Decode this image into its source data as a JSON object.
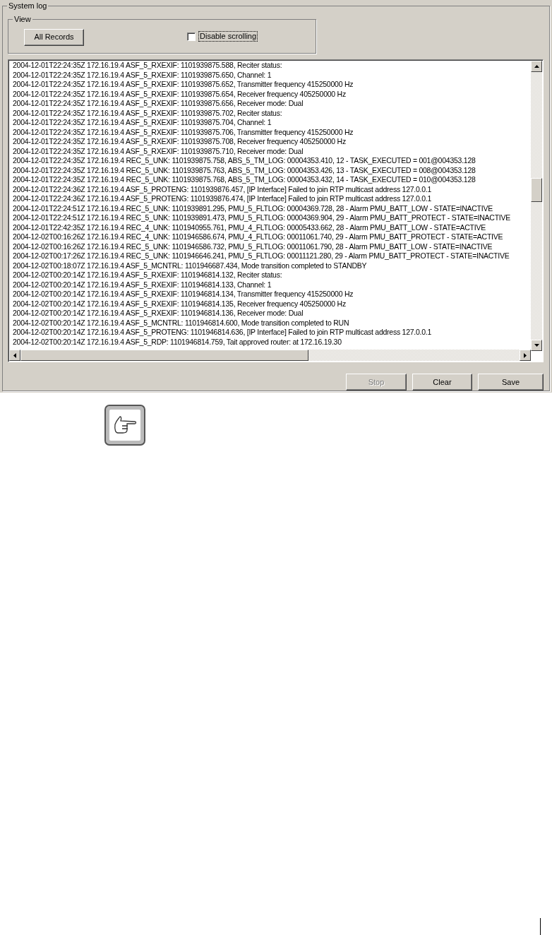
{
  "group_title": "System log",
  "view": {
    "title": "View",
    "button": "All Records",
    "checkbox": {
      "label": "Disable scrolling",
      "checked": false
    }
  },
  "log_lines": [
    "2004-12-01T22:24:35Z 172.16.19.4 ASF_5_RXEXIF: 1101939875.588, Reciter status:",
    "2004-12-01T22:24:35Z 172.16.19.4 ASF_5_RXEXIF: 1101939875.650, Channel: 1",
    "2004-12-01T22:24:35Z 172.16.19.4 ASF_5_RXEXIF: 1101939875.652, Transmitter frequency 415250000 Hz",
    "2004-12-01T22:24:35Z 172.16.19.4 ASF_5_RXEXIF: 1101939875.654, Receiver frequency 405250000 Hz",
    "2004-12-01T22:24:35Z 172.16.19.4 ASF_5_RXEXIF: 1101939875.656, Receiver mode: Dual",
    "2004-12-01T22:24:35Z 172.16.19.4 ASF_5_RXEXIF: 1101939875.702, Reciter status:",
    "2004-12-01T22:24:35Z 172.16.19.4 ASF_5_RXEXIF: 1101939875.704, Channel: 1",
    "2004-12-01T22:24:35Z 172.16.19.4 ASF_5_RXEXIF: 1101939875.706, Transmitter frequency 415250000 Hz",
    "2004-12-01T22:24:35Z 172.16.19.4 ASF_5_RXEXIF: 1101939875.708, Receiver frequency 405250000 Hz",
    "2004-12-01T22:24:35Z 172.16.19.4 ASF_5_RXEXIF: 1101939875.710, Receiver mode: Dual",
    "2004-12-01T22:24:35Z 172.16.19.4 REC_5_UNK: 1101939875.758, ABS_5_TM_LOG: 00004353.410, 12 - TASK_EXECUTED = 001@004353.128",
    "2004-12-01T22:24:35Z 172.16.19.4 REC_5_UNK: 1101939875.763, ABS_5_TM_LOG: 00004353.426, 13 - TASK_EXECUTED = 008@004353.128",
    "2004-12-01T22:24:35Z 172.16.19.4 REC_5_UNK: 1101939875.768, ABS_5_TM_LOG: 00004353.432, 14 - TASK_EXECUTED = 010@004353.128",
    "2004-12-01T22:24:36Z 172.16.19.4 ASF_5_PROTENG: 1101939876.457, [IP Interface] Failed to join RTP multicast address 127.0.0.1",
    "2004-12-01T22:24:36Z 172.16.19.4 ASF_5_PROTENG: 1101939876.474, [IP Interface] Failed to join RTP multicast address 127.0.0.1",
    "2004-12-01T22:24:51Z 172.16.19.4 REC_5_UNK: 1101939891.295, PMU_5_FLTLOG: 00004369.728, 28 - Alarm PMU_BATT_LOW - STATE=INACTIVE",
    "2004-12-01T22:24:51Z 172.16.19.4 REC_5_UNK: 1101939891.473, PMU_5_FLTLOG: 00004369.904, 29 - Alarm PMU_BATT_PROTECT - STATE=INACTIVE",
    "2004-12-01T22:42:35Z 172.16.19.4 REC_4_UNK: 1101940955.761, PMU_4_FLTLOG: 00005433.662, 28 - Alarm PMU_BATT_LOW - STATE=ACTIVE",
    "2004-12-02T00:16:26Z 172.16.19.4 REC_4_UNK: 1101946586.674, PMU_4_FLTLOG: 00011061.740, 29 - Alarm PMU_BATT_PROTECT - STATE=ACTIVE",
    "2004-12-02T00:16:26Z 172.16.19.4 REC_5_UNK: 1101946586.732, PMU_5_FLTLOG: 00011061.790, 28 - Alarm PMU_BATT_LOW - STATE=INACTIVE",
    "2004-12-02T00:17:26Z 172.16.19.4 REC_5_UNK: 1101946646.241, PMU_5_FLTLOG: 00011121.280, 29 - Alarm PMU_BATT_PROTECT - STATE=INACTIVE",
    "2004-12-02T00:18:07Z 172.16.19.4 ASF_5_MCNTRL: 1101946687.434, Mode transition completed to STANDBY",
    "2004-12-02T00:20:14Z 172.16.19.4 ASF_5_RXEXIF: 1101946814.132, Reciter status:",
    "2004-12-02T00:20:14Z 172.16.19.4 ASF_5_RXEXIF: 1101946814.133, Channel: 1",
    "2004-12-02T00:20:14Z 172.16.19.4 ASF_5_RXEXIF: 1101946814.134, Transmitter frequency 415250000 Hz",
    "2004-12-02T00:20:14Z 172.16.19.4 ASF_5_RXEXIF: 1101946814.135, Receiver frequency 405250000 Hz",
    "2004-12-02T00:20:14Z 172.16.19.4 ASF_5_RXEXIF: 1101946814.136, Receiver mode: Dual",
    "2004-12-02T00:20:14Z 172.16.19.4 ASF_5_MCNTRL: 1101946814.600, Mode transition completed to RUN",
    "2004-12-02T00:20:14Z 172.16.19.4 ASF_5_PROTENG: 1101946814.636, [IP Interface] Failed to join RTP multicast address 127.0.0.1",
    "2004-12-02T00:20:14Z 172.16.19.4 ASF_5_RDP: 1101946814.759, Tait approved router: at 172.16.19.30"
  ],
  "buttons": [
    {
      "label": "Stop",
      "disabled": true
    },
    {
      "label": "Clear",
      "disabled": false
    },
    {
      "label": "Save",
      "disabled": false
    }
  ]
}
